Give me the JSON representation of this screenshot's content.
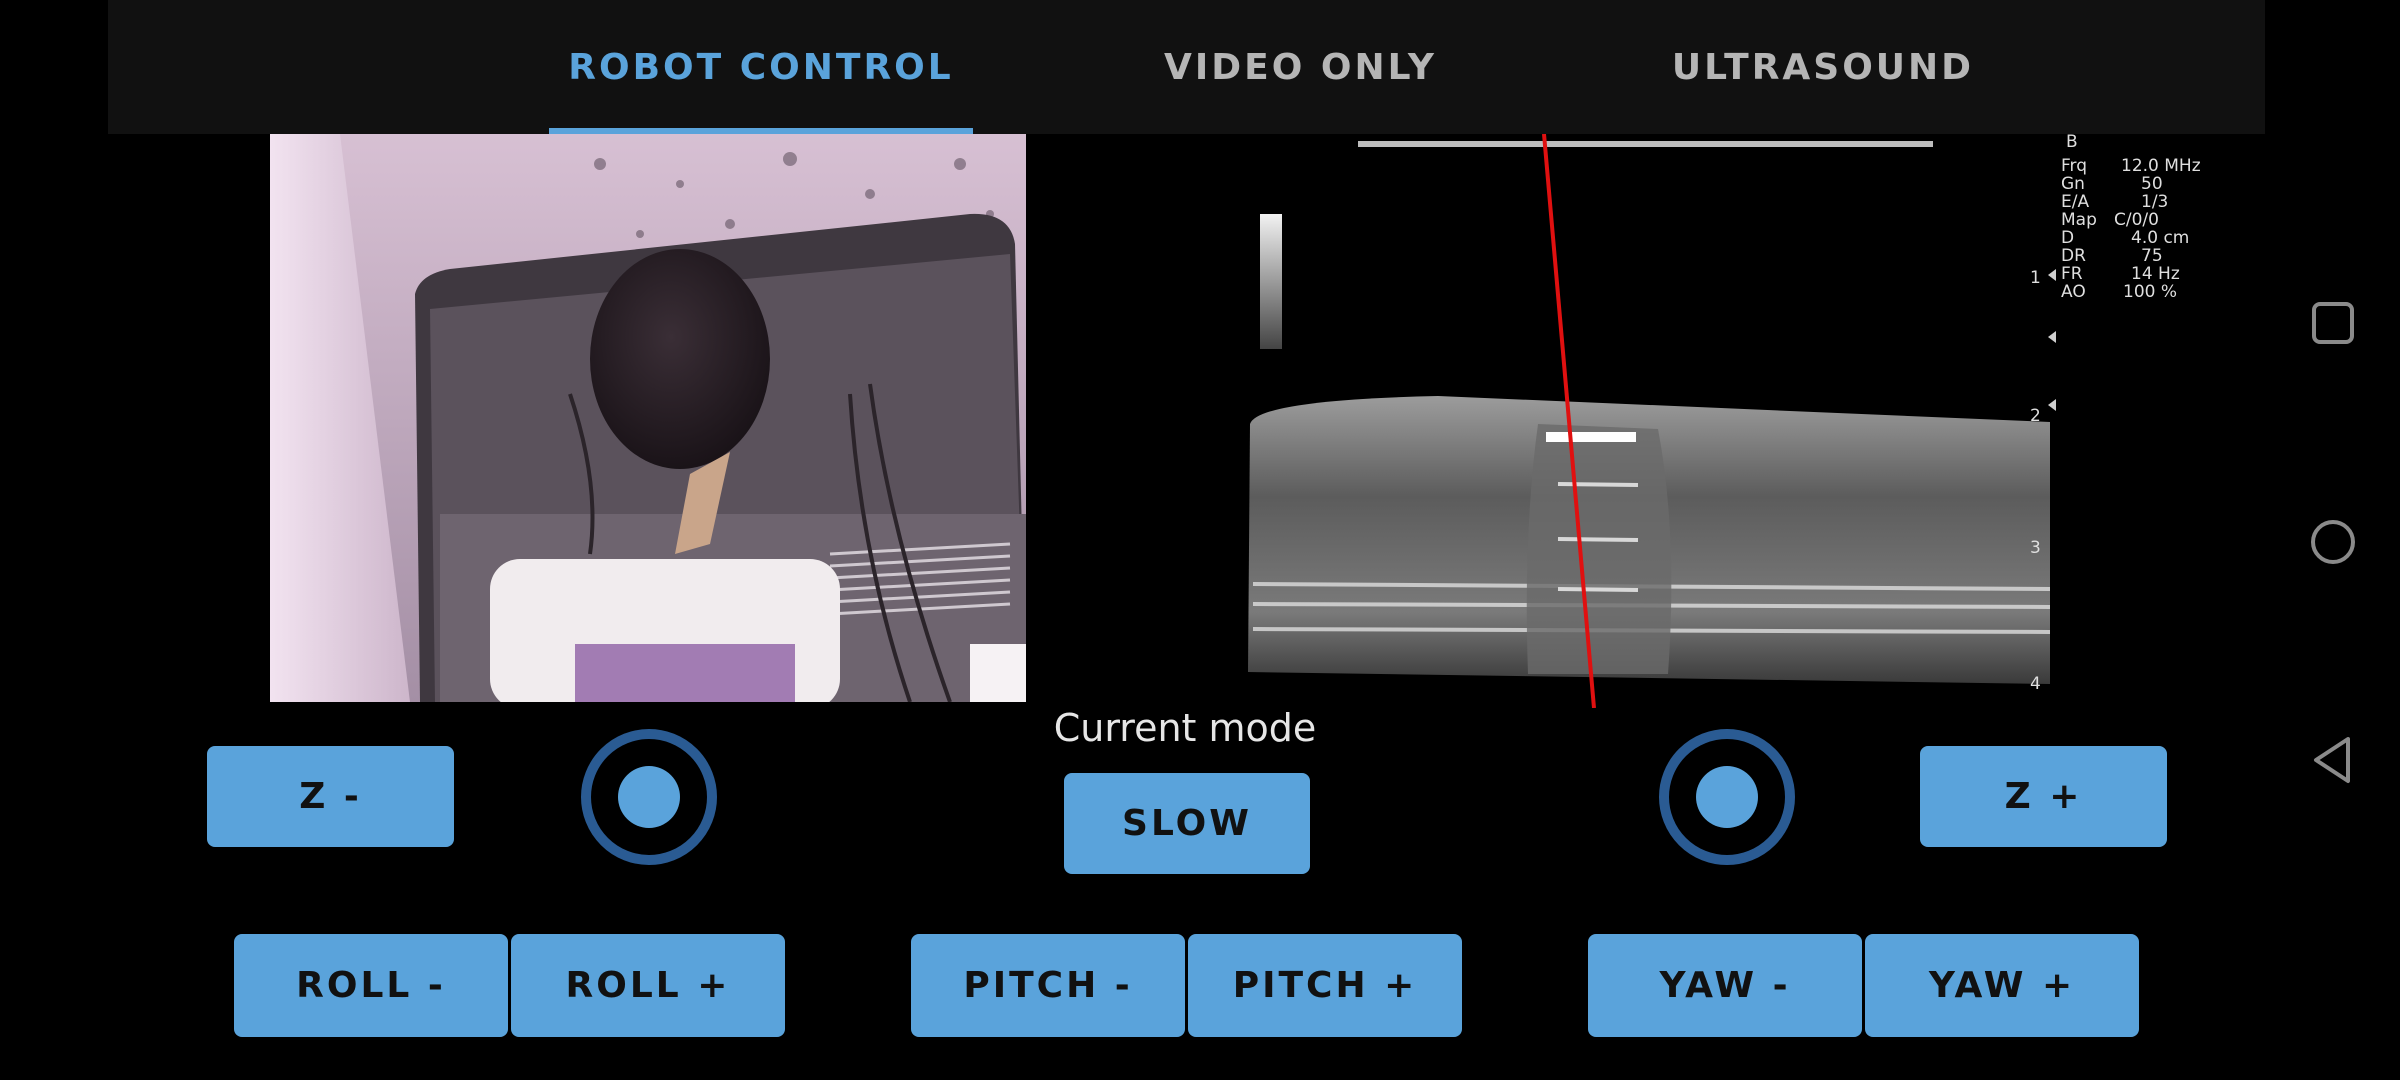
{
  "tabs": [
    {
      "label": "ROBOT CONTROL",
      "active": true
    },
    {
      "label": "VIDEO ONLY",
      "active": false
    },
    {
      "label": "ULTRASOUND",
      "active": false
    }
  ],
  "ultrasound": {
    "params": [
      {
        "key": "B",
        "value": ""
      },
      {
        "key": "Frq",
        "value": "12.0 MHz"
      },
      {
        "key": "Gn",
        "value": "50"
      },
      {
        "key": "E/A",
        "value": "1/3"
      },
      {
        "key": "Map",
        "value": "C/0/0"
      },
      {
        "key": "D",
        "value": "4.0 cm"
      },
      {
        "key": "DR",
        "value": "75"
      },
      {
        "key": "FR",
        "value": "14 Hz"
      },
      {
        "key": "AO",
        "value": "100 %"
      }
    ],
    "depth_marks": [
      "1",
      "2",
      "3",
      "4"
    ]
  },
  "controls": {
    "mode_label": "Current mode",
    "mode_value": "SLOW",
    "z_minus": "Z -",
    "z_plus": "Z +",
    "roll_minus": "ROLL -",
    "roll_plus": "ROLL +",
    "pitch_minus": "PITCH -",
    "pitch_plus": "PITCH +",
    "yaw_minus": "YAW -",
    "yaw_plus": "YAW +"
  },
  "nav": {
    "recents_icon": "square-icon",
    "home_icon": "circle-icon",
    "back_icon": "triangle-back-icon"
  },
  "colors": {
    "accent": "#5aa3db",
    "joystick_ring": "#2a5b93",
    "tabbar_bg": "#111111",
    "needle_line": "#e01010"
  }
}
